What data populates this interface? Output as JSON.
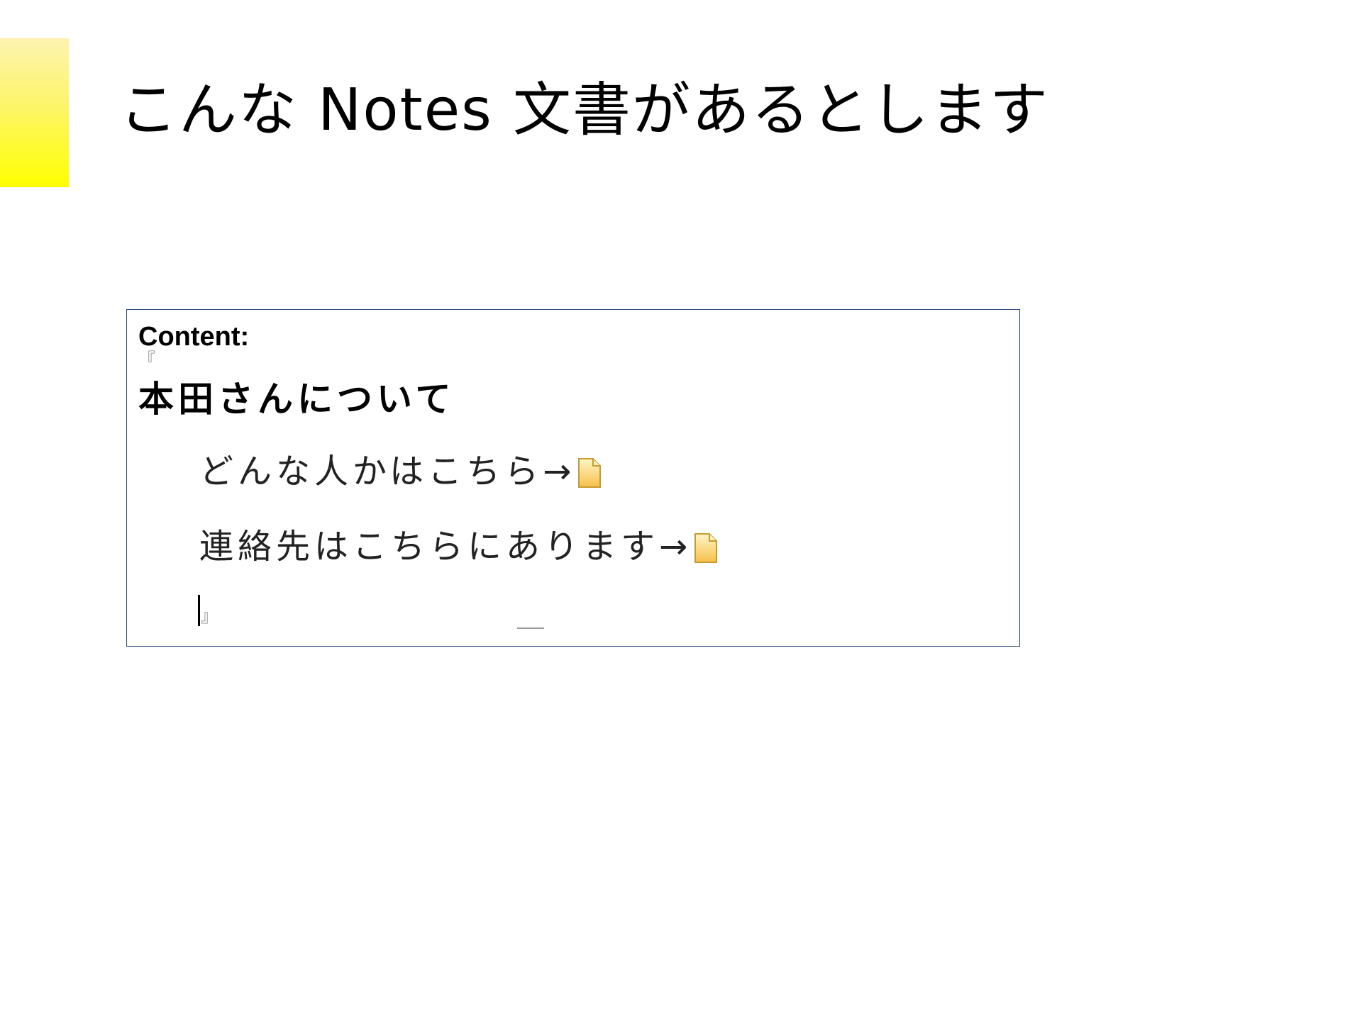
{
  "slide": {
    "title": "こんな Notes 文書があるとします",
    "accent_color": "#ffff00"
  },
  "notes_document": {
    "field_label": "Content:",
    "bracket_open": "『",
    "bracket_close": "』",
    "heading": "本田さんについて",
    "lines": [
      {
        "text": "どんな人かはこちら→",
        "icon": "doclink-icon"
      },
      {
        "text": "連絡先はこちらにあります→",
        "icon": "doclink-icon"
      }
    ],
    "frame_color": "#2c4d7e"
  }
}
